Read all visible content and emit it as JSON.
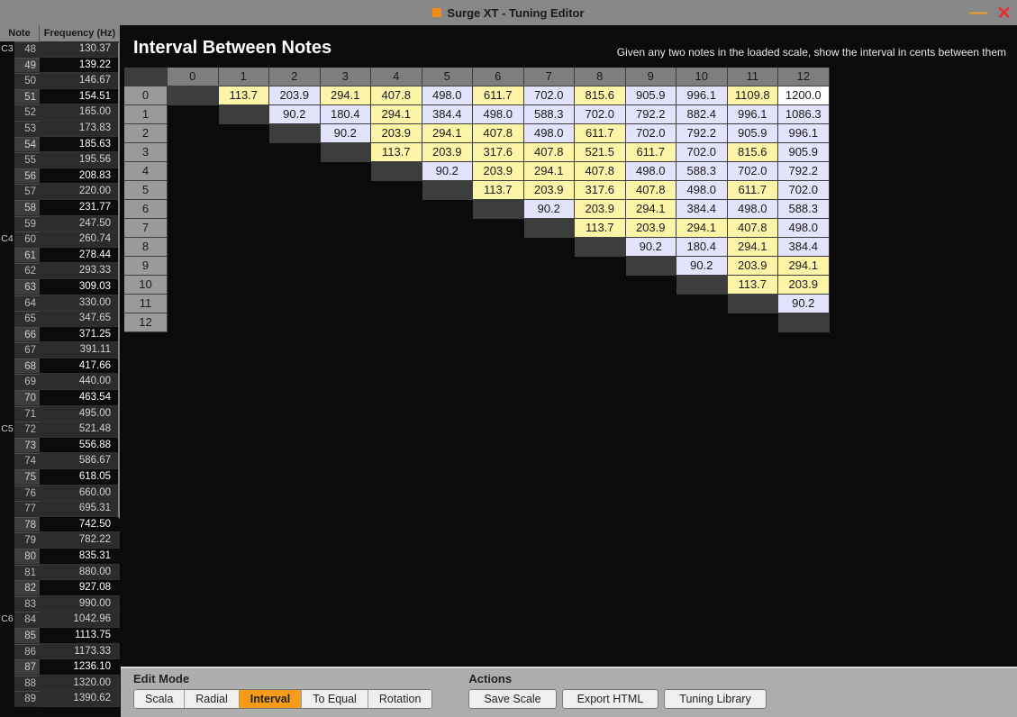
{
  "window": {
    "title": "Surge XT  -  Tuning Editor"
  },
  "sidebar": {
    "header_note": "Note",
    "header_freq": "Frequency (Hz)",
    "rows": [
      {
        "oct": "C3",
        "num": "48",
        "freq": "130.37",
        "dark": false,
        "alt": true
      },
      {
        "oct": "",
        "num": "49",
        "freq": "139.22",
        "dark": true,
        "alt": false
      },
      {
        "oct": "",
        "num": "50",
        "freq": "146.67",
        "dark": false,
        "alt": true
      },
      {
        "oct": "",
        "num": "51",
        "freq": "154.51",
        "dark": true,
        "alt": false
      },
      {
        "oct": "",
        "num": "52",
        "freq": "165.00",
        "dark": false,
        "alt": true
      },
      {
        "oct": "",
        "num": "53",
        "freq": "173.83",
        "dark": false,
        "alt": true
      },
      {
        "oct": "",
        "num": "54",
        "freq": "185.63",
        "dark": true,
        "alt": false
      },
      {
        "oct": "",
        "num": "55",
        "freq": "195.56",
        "dark": false,
        "alt": true
      },
      {
        "oct": "",
        "num": "56",
        "freq": "208.83",
        "dark": true,
        "alt": false
      },
      {
        "oct": "",
        "num": "57",
        "freq": "220.00",
        "dark": false,
        "alt": true
      },
      {
        "oct": "",
        "num": "58",
        "freq": "231.77",
        "dark": true,
        "alt": false
      },
      {
        "oct": "",
        "num": "59",
        "freq": "247.50",
        "dark": false,
        "alt": true
      },
      {
        "oct": "C4",
        "num": "60",
        "freq": "260.74",
        "dark": false,
        "alt": true
      },
      {
        "oct": "",
        "num": "61",
        "freq": "278.44",
        "dark": true,
        "alt": false
      },
      {
        "oct": "",
        "num": "62",
        "freq": "293.33",
        "dark": false,
        "alt": true
      },
      {
        "oct": "",
        "num": "63",
        "freq": "309.03",
        "dark": true,
        "alt": false
      },
      {
        "oct": "",
        "num": "64",
        "freq": "330.00",
        "dark": false,
        "alt": true
      },
      {
        "oct": "",
        "num": "65",
        "freq": "347.65",
        "dark": false,
        "alt": true
      },
      {
        "oct": "",
        "num": "66",
        "freq": "371.25",
        "dark": true,
        "alt": false
      },
      {
        "oct": "",
        "num": "67",
        "freq": "391.11",
        "dark": false,
        "alt": true
      },
      {
        "oct": "",
        "num": "68",
        "freq": "417.66",
        "dark": true,
        "alt": false
      },
      {
        "oct": "",
        "num": "69",
        "freq": "440.00",
        "dark": false,
        "alt": true
      },
      {
        "oct": "",
        "num": "70",
        "freq": "463.54",
        "dark": true,
        "alt": false
      },
      {
        "oct": "",
        "num": "71",
        "freq": "495.00",
        "dark": false,
        "alt": true
      },
      {
        "oct": "C5",
        "num": "72",
        "freq": "521.48",
        "dark": false,
        "alt": true
      },
      {
        "oct": "",
        "num": "73",
        "freq": "556.88",
        "dark": true,
        "alt": false
      },
      {
        "oct": "",
        "num": "74",
        "freq": "586.67",
        "dark": false,
        "alt": true
      },
      {
        "oct": "",
        "num": "75",
        "freq": "618.05",
        "dark": true,
        "alt": false
      },
      {
        "oct": "",
        "num": "76",
        "freq": "660.00",
        "dark": false,
        "alt": true
      },
      {
        "oct": "",
        "num": "77",
        "freq": "695.31",
        "dark": false,
        "alt": true
      },
      {
        "oct": "",
        "num": "78",
        "freq": "742.50",
        "dark": true,
        "alt": false
      },
      {
        "oct": "",
        "num": "79",
        "freq": "782.22",
        "dark": false,
        "alt": true
      },
      {
        "oct": "",
        "num": "80",
        "freq": "835.31",
        "dark": true,
        "alt": false
      },
      {
        "oct": "",
        "num": "81",
        "freq": "880.00",
        "dark": false,
        "alt": true
      },
      {
        "oct": "",
        "num": "82",
        "freq": "927.08",
        "dark": true,
        "alt": false
      },
      {
        "oct": "",
        "num": "83",
        "freq": "990.00",
        "dark": false,
        "alt": true
      },
      {
        "oct": "C6",
        "num": "84",
        "freq": "1042.96",
        "dark": false,
        "alt": true
      },
      {
        "oct": "",
        "num": "85",
        "freq": "1113.75",
        "dark": true,
        "alt": false
      },
      {
        "oct": "",
        "num": "86",
        "freq": "1173.33",
        "dark": false,
        "alt": true
      },
      {
        "oct": "",
        "num": "87",
        "freq": "1236.10",
        "dark": true,
        "alt": false
      },
      {
        "oct": "",
        "num": "88",
        "freq": "1320.00",
        "dark": false,
        "alt": true
      },
      {
        "oct": "",
        "num": "89",
        "freq": "1390.62",
        "dark": false,
        "alt": true
      }
    ]
  },
  "panel": {
    "title": "Interval Between Notes",
    "subtitle": "Given any two notes in the loaded scale, show the interval in cents between them",
    "col_headers": [
      "0",
      "1",
      "2",
      "3",
      "4",
      "5",
      "6",
      "7",
      "8",
      "9",
      "10",
      "11",
      "12"
    ],
    "row_headers": [
      "0",
      "1",
      "2",
      "3",
      "4",
      "5",
      "6",
      "7",
      "8",
      "9",
      "10",
      "11",
      "12"
    ],
    "rows": [
      [
        null,
        "113.7",
        "203.9",
        "294.1",
        "407.8",
        "498.0",
        "611.7",
        "702.0",
        "815.6",
        "905.9",
        "996.1",
        "1109.8",
        "1200.0"
      ],
      [
        null,
        null,
        "90.2",
        "180.4",
        "294.1",
        "384.4",
        "498.0",
        "588.3",
        "702.0",
        "792.2",
        "882.4",
        "996.1",
        "1086.3"
      ],
      [
        null,
        null,
        null,
        "90.2",
        "203.9",
        "294.1",
        "407.8",
        "498.0",
        "611.7",
        "702.0",
        "792.2",
        "905.9",
        "996.1"
      ],
      [
        null,
        null,
        null,
        null,
        "113.7",
        "203.9",
        "317.6",
        "407.8",
        "521.5",
        "611.7",
        "702.0",
        "815.6",
        "905.9"
      ],
      [
        null,
        null,
        null,
        null,
        null,
        "90.2",
        "203.9",
        "294.1",
        "407.8",
        "498.0",
        "588.3",
        "702.0",
        "792.2"
      ],
      [
        null,
        null,
        null,
        null,
        null,
        null,
        "113.7",
        "203.9",
        "317.6",
        "407.8",
        "498.0",
        "611.7",
        "702.0"
      ],
      [
        null,
        null,
        null,
        null,
        null,
        null,
        null,
        "90.2",
        "203.9",
        "294.1",
        "384.4",
        "498.0",
        "588.3"
      ],
      [
        null,
        null,
        null,
        null,
        null,
        null,
        null,
        null,
        "113.7",
        "203.9",
        "294.1",
        "407.8",
        "498.0"
      ],
      [
        null,
        null,
        null,
        null,
        null,
        null,
        null,
        null,
        null,
        "90.2",
        "180.4",
        "294.1",
        "384.4"
      ],
      [
        null,
        null,
        null,
        null,
        null,
        null,
        null,
        null,
        null,
        null,
        "90.2",
        "203.9",
        "294.1"
      ],
      [
        null,
        null,
        null,
        null,
        null,
        null,
        null,
        null,
        null,
        null,
        null,
        "113.7",
        "203.9"
      ],
      [
        null,
        null,
        null,
        null,
        null,
        null,
        null,
        null,
        null,
        null,
        null,
        null,
        "90.2"
      ],
      [
        null,
        null,
        null,
        null,
        null,
        null,
        null,
        null,
        null,
        null,
        null,
        null,
        null
      ]
    ],
    "colors": [
      [
        0,
        1,
        2,
        1,
        1,
        2,
        1,
        2,
        1,
        2,
        2,
        1,
        3
      ],
      [
        0,
        0,
        2,
        2,
        1,
        2,
        2,
        2,
        2,
        2,
        2,
        2,
        2
      ],
      [
        0,
        0,
        0,
        2,
        1,
        1,
        1,
        2,
        1,
        2,
        2,
        2,
        2
      ],
      [
        0,
        0,
        0,
        0,
        1,
        1,
        1,
        1,
        1,
        1,
        2,
        1,
        2
      ],
      [
        0,
        0,
        0,
        0,
        0,
        2,
        1,
        1,
        1,
        2,
        2,
        2,
        2
      ],
      [
        0,
        0,
        0,
        0,
        0,
        0,
        1,
        1,
        1,
        1,
        2,
        1,
        2
      ],
      [
        0,
        0,
        0,
        0,
        0,
        0,
        0,
        2,
        1,
        1,
        2,
        2,
        2
      ],
      [
        0,
        0,
        0,
        0,
        0,
        0,
        0,
        0,
        1,
        1,
        1,
        1,
        2
      ],
      [
        0,
        0,
        0,
        0,
        0,
        0,
        0,
        0,
        0,
        2,
        2,
        1,
        2
      ],
      [
        0,
        0,
        0,
        0,
        0,
        0,
        0,
        0,
        0,
        0,
        2,
        1,
        1
      ],
      [
        0,
        0,
        0,
        0,
        0,
        0,
        0,
        0,
        0,
        0,
        0,
        1,
        1
      ],
      [
        0,
        0,
        0,
        0,
        0,
        0,
        0,
        0,
        0,
        0,
        0,
        0,
        2
      ],
      [
        0,
        0,
        0,
        0,
        0,
        0,
        0,
        0,
        0,
        0,
        0,
        0,
        0
      ]
    ]
  },
  "edit_mode": {
    "title": "Edit Mode",
    "options": [
      "Scala",
      "Radial",
      "Interval",
      "To Equal",
      "Rotation"
    ],
    "active": "Interval"
  },
  "actions": {
    "title": "Actions",
    "buttons": [
      "Save Scale",
      "Export HTML",
      "Tuning Library"
    ]
  }
}
